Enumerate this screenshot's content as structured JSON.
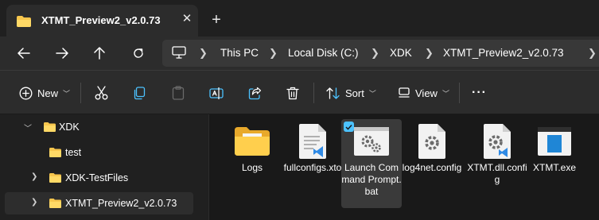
{
  "tab": {
    "title": "XTMT_Preview2_v2.0.73",
    "close": "✕",
    "new_tab": "+"
  },
  "nav": {
    "breadcrumbs": [
      "This PC",
      "Local Disk (C:)",
      "XDK",
      "XTMT_Preview2_v2.0.73"
    ]
  },
  "toolbar": {
    "new_label": "New",
    "sort_label": "Sort",
    "view_label": "View",
    "more": "···"
  },
  "tree": [
    {
      "label": "XDK",
      "expanded": true
    },
    {
      "label": "test"
    },
    {
      "label": "XDK-TestFiles",
      "expanded": false
    },
    {
      "label": "XTMT_Preview2_v2.0.73",
      "expanded": false,
      "selected": true
    }
  ],
  "files": [
    {
      "name": "Logs",
      "icon": "folder-icon"
    },
    {
      "name": "fullconfigs.xto",
      "icon": "vscode-file-icon"
    },
    {
      "name": "Launch Command Prompt.bat",
      "icon": "batch-file-icon",
      "selected": true
    },
    {
      "name": "log4net.config",
      "icon": "config-file-icon"
    },
    {
      "name": "XTMT.dll.config",
      "icon": "config-file-icon"
    },
    {
      "name": "XTMT.exe",
      "icon": "exe-icon"
    }
  ],
  "colors": {
    "accent": "#4cc2ff",
    "folder": "#f7c64d",
    "vscode": "#2f8ae5"
  }
}
